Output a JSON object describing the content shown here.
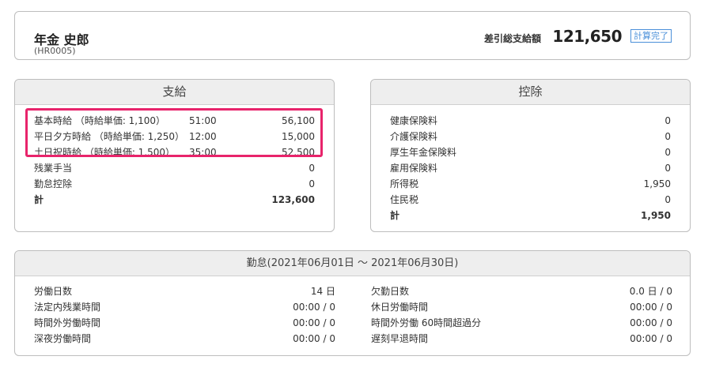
{
  "header": {
    "name": "年金 史郎",
    "code": "(HR0005)",
    "net_label": "差引総支給額",
    "net_amount": "121,650",
    "status_badge": "計算完了"
  },
  "payment": {
    "title": "支給",
    "rows": [
      {
        "label": "基本時給 （時給単価: 1,100）",
        "hours": "51:00",
        "value": "56,100"
      },
      {
        "label": "平日夕方時給 （時給単価: 1,250）",
        "hours": "12:00",
        "value": "15,000"
      },
      {
        "label": "土日祝時給 （時給単価: 1,500）",
        "hours": "35:00",
        "value": "52,500"
      },
      {
        "label": "残業手当",
        "hours": "",
        "value": "0"
      },
      {
        "label": "勤怠控除",
        "hours": "",
        "value": "0"
      }
    ],
    "total_label": "計",
    "total_value": "123,600"
  },
  "deduction": {
    "title": "控除",
    "rows": [
      {
        "label": "健康保険料",
        "value": "0"
      },
      {
        "label": "介護保険料",
        "value": "0"
      },
      {
        "label": "厚生年金保険料",
        "value": "0"
      },
      {
        "label": "雇用保険料",
        "value": "0"
      },
      {
        "label": "所得税",
        "value": "1,950"
      },
      {
        "label": "住民税",
        "value": "0"
      }
    ],
    "total_label": "計",
    "total_value": "1,950"
  },
  "attendance": {
    "title": "勤怠(2021年06月01日 〜 2021年06月30日)",
    "left": [
      {
        "label": "労働日数",
        "value": "14 日"
      },
      {
        "label": "法定内残業時間",
        "value": "00:00 / 0"
      },
      {
        "label": "時間外労働時間",
        "value": "00:00 / 0"
      },
      {
        "label": "深夜労働時間",
        "value": "00:00 / 0"
      }
    ],
    "right": [
      {
        "label": "欠勤日数",
        "value": "0.0 日 / 0"
      },
      {
        "label": "休日労働時間",
        "value": "00:00 / 0"
      },
      {
        "label": "時間外労働 60時間超過分",
        "value": "00:00 / 0"
      },
      {
        "label": "遅刻早退時間",
        "value": "00:00 / 0"
      }
    ]
  },
  "colors": {
    "highlight": "#e8246b",
    "badge": "#4a8fd9"
  }
}
